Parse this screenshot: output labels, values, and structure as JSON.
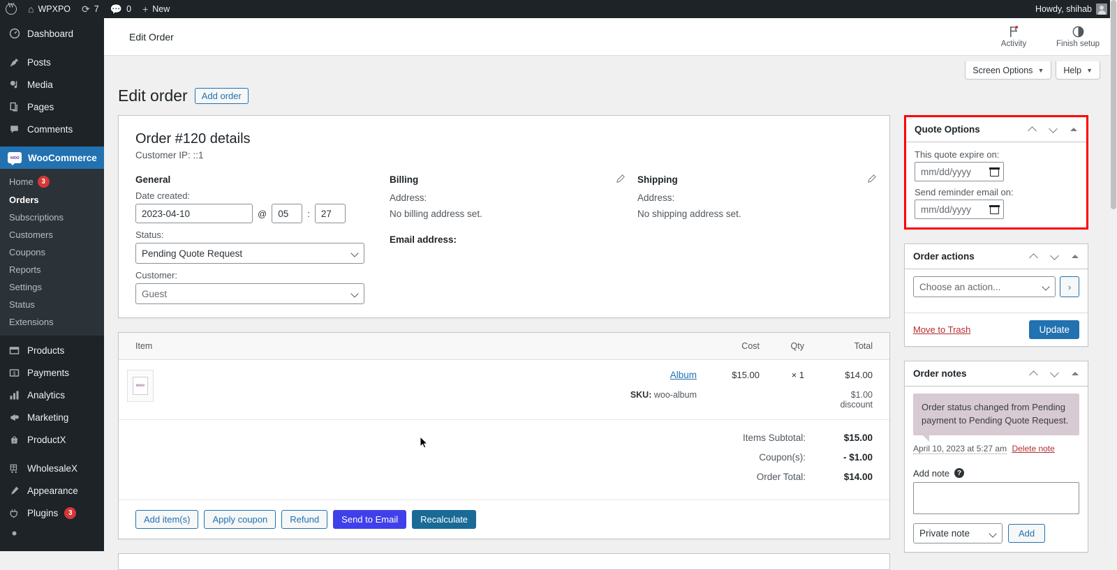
{
  "adminbar": {
    "logo_icon": "wordpress-logo-icon",
    "site_name": "WPXPO",
    "updates_count": "7",
    "comments_count": "0",
    "new_label": "New",
    "howdy": "Howdy, shihab"
  },
  "sidebar": {
    "items": [
      {
        "label": "Dashboard",
        "icon": "dashboard-icon"
      },
      {
        "label": "Posts",
        "icon": "pin-icon"
      },
      {
        "label": "Media",
        "icon": "media-icon"
      },
      {
        "label": "Pages",
        "icon": "pages-icon"
      },
      {
        "label": "Comments",
        "icon": "comment-icon"
      },
      {
        "label": "WooCommerce",
        "icon": "woocommerce-icon",
        "current": true
      },
      {
        "label": "Products",
        "icon": "products-icon"
      },
      {
        "label": "Payments",
        "icon": "payments-icon"
      },
      {
        "label": "Analytics",
        "icon": "analytics-icon"
      },
      {
        "label": "Marketing",
        "icon": "marketing-icon"
      },
      {
        "label": "ProductX",
        "icon": "productx-icon"
      },
      {
        "label": "WholesaleX",
        "icon": "wholesalex-icon"
      },
      {
        "label": "Appearance",
        "icon": "appearance-icon"
      },
      {
        "label": "Plugins",
        "icon": "plugins-icon",
        "badge": "3"
      }
    ],
    "woo_submenu": [
      {
        "label": "Home",
        "badge": "3"
      },
      {
        "label": "Orders",
        "current": true
      },
      {
        "label": "Subscriptions"
      },
      {
        "label": "Customers"
      },
      {
        "label": "Coupons"
      },
      {
        "label": "Reports"
      },
      {
        "label": "Settings"
      },
      {
        "label": "Status"
      },
      {
        "label": "Extensions"
      }
    ]
  },
  "woo_header": {
    "breadcrumb": "Edit Order",
    "activity_label": "Activity",
    "finish_setup_label": "Finish setup"
  },
  "screen_meta": {
    "screen_options": "Screen Options",
    "help": "Help",
    "caret": "▼"
  },
  "page": {
    "title": "Edit order",
    "add_order_label": "Add order"
  },
  "order": {
    "heading": "Order #120 details",
    "customer_ip": "Customer IP: ::1",
    "general": {
      "section_title": "General",
      "date_label": "Date created:",
      "date_value": "2023-04-10",
      "at_symbol": "@",
      "hour_value": "05",
      "time_sep": ":",
      "minute_value": "27",
      "status_label": "Status:",
      "status_value": "Pending Quote Request",
      "customer_label": "Customer:",
      "customer_value": "Guest"
    },
    "billing": {
      "section_title": "Billing",
      "address_label": "Address:",
      "address_value": "No billing address set.",
      "email_label": "Email address:",
      "edit_icon": "pencil-icon"
    },
    "shipping": {
      "section_title": "Shipping",
      "address_label": "Address:",
      "address_value": "No shipping address set.",
      "edit_icon": "pencil-icon"
    }
  },
  "items": {
    "columns": {
      "item": "Item",
      "cost": "Cost",
      "qty": "Qty",
      "total": "Total"
    },
    "rows": [
      {
        "name": "Album",
        "sku": "SKU:",
        "sku_value": "woo-album",
        "thumb_label": "woo",
        "cost": "$15.00",
        "qty": "× 1",
        "total": "$14.00",
        "total_note": "$1.00 discount"
      }
    ],
    "totals": [
      {
        "label": "Items Subtotal:",
        "value": "$15.00"
      },
      {
        "label": "Coupon(s):",
        "value": "- $1.00"
      },
      {
        "label": "Order Total:",
        "value": "$14.00"
      }
    ],
    "actions": {
      "add_items": "Add item(s)",
      "apply_coupon": "Apply coupon",
      "refund": "Refund",
      "send_to_email": "Send to Email",
      "recalculate": "Recalculate"
    }
  },
  "quote_options": {
    "title": "Quote Options",
    "expire_label": "This quote expire on:",
    "expire_placeholder": "mm/dd/yyyy",
    "reminder_label": "Send reminder email on:",
    "reminder_placeholder": "mm/dd/yyyy",
    "highlight_color": "#ff0000"
  },
  "order_actions": {
    "title": "Order actions",
    "choose_action": "Choose an action...",
    "go_label": "›",
    "move_to_trash": "Move to Trash",
    "update_label": "Update"
  },
  "order_notes": {
    "title": "Order notes",
    "notes": [
      {
        "text": "Order status changed from Pending payment to Pending Quote Request.",
        "date": "April 10, 2023 at 5:27 am",
        "delete_label": "Delete note"
      }
    ],
    "add_note_label": "Add note",
    "help_icon": "help-icon",
    "note_value": "",
    "note_type": "Private note",
    "add_button": "Add"
  },
  "colors": {
    "wp_blue": "#2271b1",
    "woo_purple": "#7f54b3",
    "admin_dark": "#1d2327",
    "danger": "#d63638",
    "violet_btn": "#4040ea",
    "teal_btn": "#1a6a96",
    "note_bubble": "#d7cad2"
  }
}
